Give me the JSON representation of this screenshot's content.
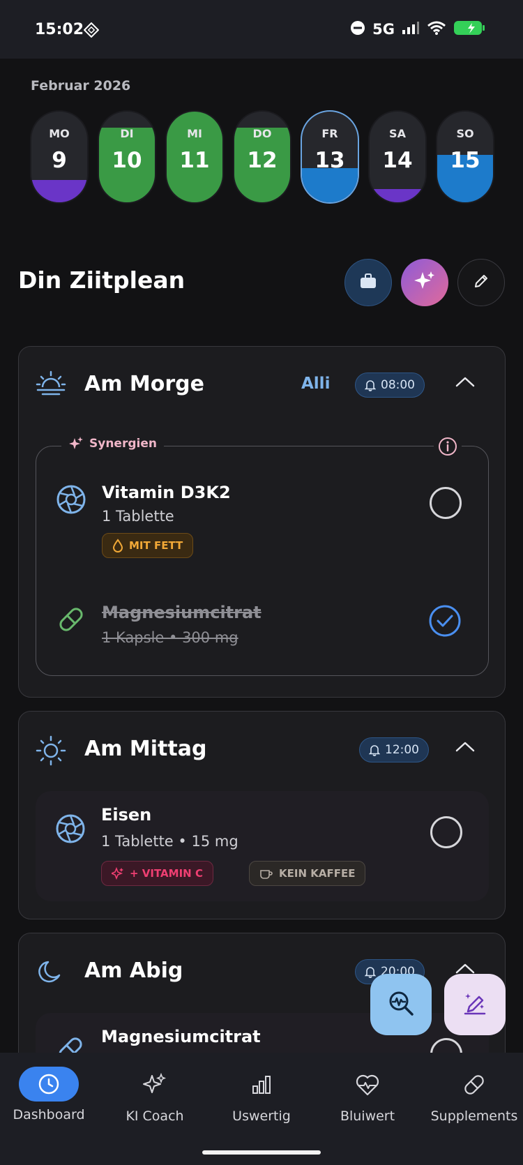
{
  "status_bar": {
    "time": "15:02",
    "network": "5G"
  },
  "calendar": {
    "month_label": "Februar 2026",
    "days": [
      {
        "label": "MO",
        "number": "9",
        "fill_level": 0.25,
        "fill_color": "#6a35c7"
      },
      {
        "label": "DI",
        "number": "10",
        "fill_level": 0.82,
        "fill_color": "#3a9a45"
      },
      {
        "label": "MI",
        "number": "11",
        "fill_level": 1.0,
        "fill_color": "#3a9a45"
      },
      {
        "label": "DO",
        "number": "12",
        "fill_level": 0.82,
        "fill_color": "#3a9a45"
      },
      {
        "label": "FR",
        "number": "13",
        "fill_level": 0.38,
        "fill_color": "#1d7bcb",
        "selected": true
      },
      {
        "label": "SA",
        "number": "14",
        "fill_level": 0.15,
        "fill_color": "#6a35c7"
      },
      {
        "label": "SO",
        "number": "15",
        "fill_level": 0.52,
        "fill_color": "#1d7bcb"
      }
    ]
  },
  "plan": {
    "title": "Din Ziitplean"
  },
  "sections": {
    "morning": {
      "name": "Am Morge",
      "all_label": "Alli",
      "time": "08:00",
      "synergy_label": "Synergien",
      "items": [
        {
          "name": "Vitamin D3K2",
          "dose": "1 Tablette",
          "tag": "MIT FETT",
          "checked": false
        },
        {
          "name": "Magnesiumcitrat",
          "dose": "1 Kapsle  •  300 mg",
          "checked": true
        }
      ]
    },
    "noon": {
      "name": "Am Mittag",
      "time": "12:00",
      "items": [
        {
          "name": "Eisen",
          "dose": "1 Tablette  •  15 mg",
          "tags": [
            "+ VITAMIN C",
            "KEIN KAFFEE"
          ],
          "checked": false
        }
      ]
    },
    "evening": {
      "name": "Am Abig",
      "time": "20:00",
      "items": [
        {
          "name": "Magnesiumcitrat",
          "checked": false
        }
      ]
    }
  },
  "bottom_nav": {
    "items": [
      "Dashboard",
      "KI Coach",
      "Uswertig",
      "Bluiwert",
      "Supplements"
    ],
    "active": "Dashboard"
  },
  "colors": {
    "accent": "#3a83ef",
    "green": "#3a9a45",
    "purple": "#6a35c7",
    "blue": "#1d7bcb"
  }
}
